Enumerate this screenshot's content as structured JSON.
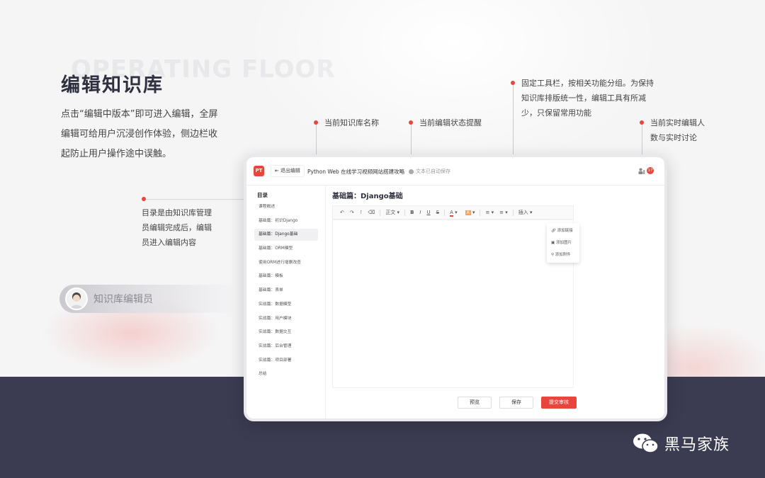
{
  "watermark": "OPERATING FLOOR",
  "title": "编辑知识库",
  "intro": "点击“编辑中版本”即可进入编辑，全屏编辑可给用户沉浸创作体验，侧边栏收起防止用户操作途中误触。",
  "annotations": {
    "kb_name": "当前知识库名称",
    "edit_status": "当前编辑状态提醒",
    "toolbar": "固定工具栏，按相关功能分组。为保持知识库排版统一性，编辑工具有所减少，只保留常用功能",
    "realtime": "当前实时编辑人数与实时讨论",
    "toc": "目录是由知识库管理员编辑完成后，编辑员进入编辑内容"
  },
  "role_label": "知识库编辑员",
  "app": {
    "logo": "PT",
    "exit_label": "退出编辑",
    "kb_name": "Python Web 在线学习视频网站搭建攻略",
    "save_status": "文本已自动保存",
    "online_count": "17",
    "sidebar_title": "目录",
    "toc": [
      "课程概述",
      "基础篇：初识Django",
      "基础篇：Django基础",
      "基础篇：ORM模型",
      "使用ORM进行增删改查",
      "基础篇：模板",
      "基础篇：表单",
      "实战篇：数据模型",
      "实战篇：用户模块",
      "实战篇：数据交互",
      "实战篇：后台管理",
      "实战篇：项目部署",
      "总结"
    ],
    "active_index": 2,
    "doc_title": "基础篇：Django基础",
    "toolbar": {
      "undo": "↶",
      "redo": "↷",
      "format_painter": "⊺",
      "clear": "⌫",
      "paragraph": "正文",
      "bold": "B",
      "italic": "I",
      "underline": "U",
      "strike": "S",
      "font_color": "A",
      "highlight": "A",
      "list_ordered": "≡",
      "list_bullet": "≡",
      "insert": "插入"
    },
    "insert_menu": [
      "添加链接",
      "添加图片",
      "添加附件"
    ],
    "buttons": {
      "preview": "预览",
      "save": "保存",
      "submit": "提交审核"
    }
  },
  "brand": "黑马家族",
  "colors": {
    "accent": "#e8453c",
    "dark_band": "#3b3c52",
    "title": "#2f3040"
  }
}
